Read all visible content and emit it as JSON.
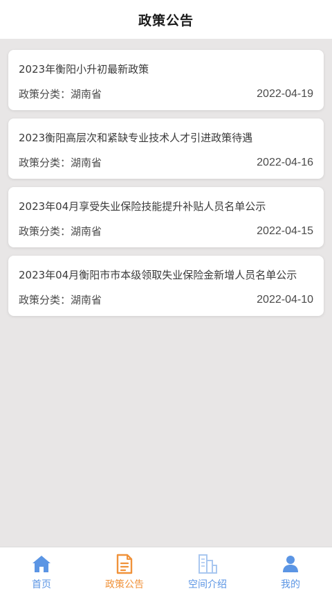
{
  "header": {
    "title": "政策公告"
  },
  "policies": [
    {
      "title": "2023年衡阳小升初最新政策",
      "category": "政策分类：湖南省",
      "date": "2022-04-19"
    },
    {
      "title": "2023衡阳高层次和紧缺专业技术人才引进政策待遇",
      "category": "政策分类：湖南省",
      "date": "2022-04-16"
    },
    {
      "title": "2023年04月享受失业保险技能提升补贴人员名单公示",
      "category": "政策分类：湖南省",
      "date": "2022-04-15"
    },
    {
      "title": "2023年04月衡阳市市本级领取失业保险金新增人员名单公示",
      "category": "政策分类：湖南省",
      "date": "2022-04-10"
    }
  ],
  "tabbar": {
    "items": [
      {
        "label": "首页",
        "icon": "home-icon",
        "active": false
      },
      {
        "label": "政策公告",
        "icon": "document-icon",
        "active": true
      },
      {
        "label": "空间介绍",
        "icon": "building-icon",
        "active": false
      },
      {
        "label": "我的",
        "icon": "user-icon",
        "active": false
      }
    ]
  },
  "colors": {
    "active": "#f0923a",
    "inactive": "#5b95e4",
    "background": "#e8e6e6"
  }
}
